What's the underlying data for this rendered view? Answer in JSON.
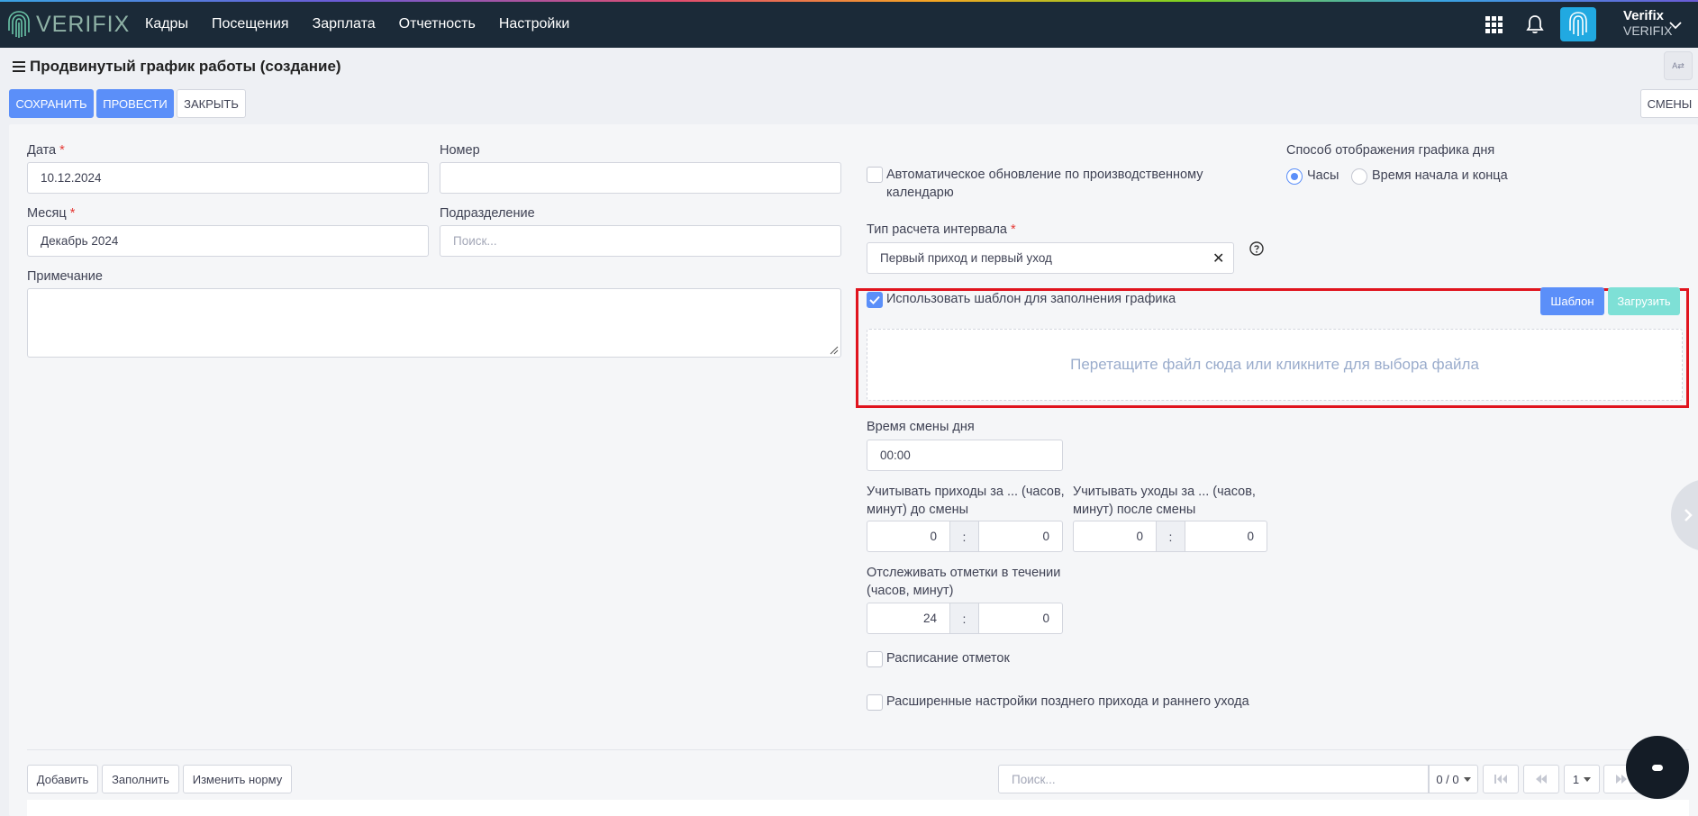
{
  "brand": {
    "name": "VERIFIX"
  },
  "nav": {
    "items": [
      "Кадры",
      "Посещения",
      "Зарплата",
      "Отчетность",
      "Настройки"
    ]
  },
  "user": {
    "name": "Verifix",
    "company": "VERIFIX"
  },
  "page": {
    "title": "Продвинутый график работы (создание)",
    "lang_badge": "A⇄"
  },
  "toolbar": {
    "save": "СОХРАНИТЬ",
    "post": "ПРОВЕСТИ",
    "close": "ЗАКРЫТЬ",
    "shifts": "СМЕНЫ"
  },
  "form": {
    "date": {
      "label": "Дата",
      "required": "*",
      "value": "10.12.2024"
    },
    "number": {
      "label": "Номер",
      "value": ""
    },
    "month": {
      "label": "Месяц",
      "required": "*",
      "value": "Декабрь 2024"
    },
    "division": {
      "label": "Подразделение",
      "placeholder": "Поиск..."
    },
    "note": {
      "label": "Примечание",
      "value": ""
    },
    "auto_update": {
      "label_line1": "Автоматическое обновление по производственному",
      "label_line2": "календарю",
      "checked": false
    },
    "interval_type": {
      "label": "Тип расчета интервала",
      "required": "*",
      "value": "Первый приход и первый уход"
    },
    "display_mode": {
      "label": "Способ отображения графика дня",
      "options": [
        "Часы",
        "Время начала и конца"
      ],
      "selected": "Часы"
    },
    "use_template": {
      "label": "Использовать шаблон для заполнения графика",
      "checked": true,
      "template_button": "Шаблон",
      "upload_button": "Загрузить",
      "dropzone_text": "Перетащите файл сюда или кликните для выбора файла"
    },
    "shift_change_time": {
      "label": "Время смены дня",
      "value": "00:00"
    },
    "arrivals_before": {
      "label_line1": "Учитывать приходы за ... (часов,",
      "label_line2": "минут) до смены",
      "hours": "0",
      "minutes": "0"
    },
    "departures_after": {
      "label_line1": "Учитывать уходы за ... (часов,",
      "label_line2": "минут) после смены",
      "hours": "0",
      "minutes": "0"
    },
    "track_marks": {
      "label_line1": "Отслеживать отметки в течении",
      "label_line2": "(часов, минут)",
      "hours": "24",
      "minutes": "0"
    },
    "separator": ":",
    "marks_schedule": {
      "label": "Расписание отметок",
      "checked": false
    },
    "extended_late": {
      "label": "Расширенные настройки позднего прихода и раннего ухода",
      "checked": false
    }
  },
  "table_toolbar": {
    "add": "Добавить",
    "fill": "Заполнить",
    "change_norm": "Изменить норму",
    "search_placeholder": "Поиск...",
    "count": "0 / 0",
    "page": "1"
  },
  "colors": {
    "primary": "#5b8ff9",
    "navbar": "#1b2a38",
    "highlight": "#e0141e",
    "upload": "#7ee0d6"
  }
}
